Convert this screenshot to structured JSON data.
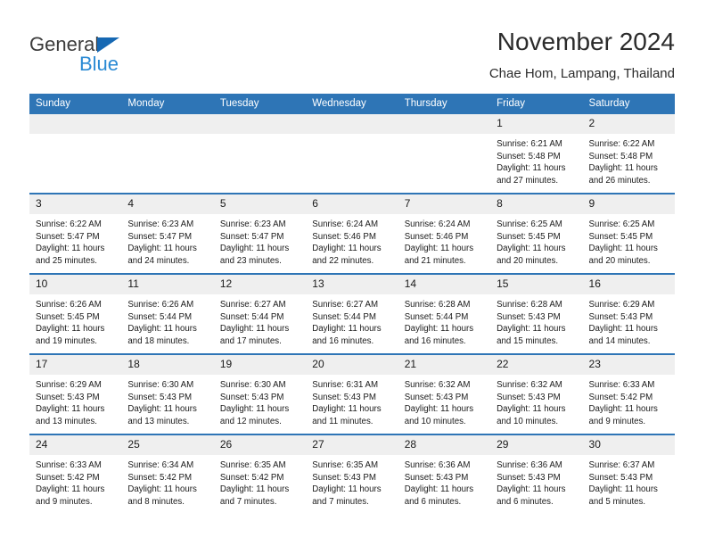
{
  "brand": {
    "name_dark": "General",
    "name_blue": "Blue",
    "triangle_color": "#1668b3",
    "blue_text_color": "#2a8ad4"
  },
  "header": {
    "title": "November 2024",
    "subtitle": "Chae Hom, Lampang, Thailand",
    "accent_color": "#2e75b6"
  },
  "weekdays": [
    "Sunday",
    "Monday",
    "Tuesday",
    "Wednesday",
    "Thursday",
    "Friday",
    "Saturday"
  ],
  "weeks": [
    [
      {
        "day": "",
        "sunrise": "",
        "sunset": "",
        "daylight1": "",
        "daylight2": ""
      },
      {
        "day": "",
        "sunrise": "",
        "sunset": "",
        "daylight1": "",
        "daylight2": ""
      },
      {
        "day": "",
        "sunrise": "",
        "sunset": "",
        "daylight1": "",
        "daylight2": ""
      },
      {
        "day": "",
        "sunrise": "",
        "sunset": "",
        "daylight1": "",
        "daylight2": ""
      },
      {
        "day": "",
        "sunrise": "",
        "sunset": "",
        "daylight1": "",
        "daylight2": ""
      },
      {
        "day": "1",
        "sunrise": "Sunrise: 6:21 AM",
        "sunset": "Sunset: 5:48 PM",
        "daylight1": "Daylight: 11 hours",
        "daylight2": "and 27 minutes."
      },
      {
        "day": "2",
        "sunrise": "Sunrise: 6:22 AM",
        "sunset": "Sunset: 5:48 PM",
        "daylight1": "Daylight: 11 hours",
        "daylight2": "and 26 minutes."
      }
    ],
    [
      {
        "day": "3",
        "sunrise": "Sunrise: 6:22 AM",
        "sunset": "Sunset: 5:47 PM",
        "daylight1": "Daylight: 11 hours",
        "daylight2": "and 25 minutes."
      },
      {
        "day": "4",
        "sunrise": "Sunrise: 6:23 AM",
        "sunset": "Sunset: 5:47 PM",
        "daylight1": "Daylight: 11 hours",
        "daylight2": "and 24 minutes."
      },
      {
        "day": "5",
        "sunrise": "Sunrise: 6:23 AM",
        "sunset": "Sunset: 5:47 PM",
        "daylight1": "Daylight: 11 hours",
        "daylight2": "and 23 minutes."
      },
      {
        "day": "6",
        "sunrise": "Sunrise: 6:24 AM",
        "sunset": "Sunset: 5:46 PM",
        "daylight1": "Daylight: 11 hours",
        "daylight2": "and 22 minutes."
      },
      {
        "day": "7",
        "sunrise": "Sunrise: 6:24 AM",
        "sunset": "Sunset: 5:46 PM",
        "daylight1": "Daylight: 11 hours",
        "daylight2": "and 21 minutes."
      },
      {
        "day": "8",
        "sunrise": "Sunrise: 6:25 AM",
        "sunset": "Sunset: 5:45 PM",
        "daylight1": "Daylight: 11 hours",
        "daylight2": "and 20 minutes."
      },
      {
        "day": "9",
        "sunrise": "Sunrise: 6:25 AM",
        "sunset": "Sunset: 5:45 PM",
        "daylight1": "Daylight: 11 hours",
        "daylight2": "and 20 minutes."
      }
    ],
    [
      {
        "day": "10",
        "sunrise": "Sunrise: 6:26 AM",
        "sunset": "Sunset: 5:45 PM",
        "daylight1": "Daylight: 11 hours",
        "daylight2": "and 19 minutes."
      },
      {
        "day": "11",
        "sunrise": "Sunrise: 6:26 AM",
        "sunset": "Sunset: 5:44 PM",
        "daylight1": "Daylight: 11 hours",
        "daylight2": "and 18 minutes."
      },
      {
        "day": "12",
        "sunrise": "Sunrise: 6:27 AM",
        "sunset": "Sunset: 5:44 PM",
        "daylight1": "Daylight: 11 hours",
        "daylight2": "and 17 minutes."
      },
      {
        "day": "13",
        "sunrise": "Sunrise: 6:27 AM",
        "sunset": "Sunset: 5:44 PM",
        "daylight1": "Daylight: 11 hours",
        "daylight2": "and 16 minutes."
      },
      {
        "day": "14",
        "sunrise": "Sunrise: 6:28 AM",
        "sunset": "Sunset: 5:44 PM",
        "daylight1": "Daylight: 11 hours",
        "daylight2": "and 16 minutes."
      },
      {
        "day": "15",
        "sunrise": "Sunrise: 6:28 AM",
        "sunset": "Sunset: 5:43 PM",
        "daylight1": "Daylight: 11 hours",
        "daylight2": "and 15 minutes."
      },
      {
        "day": "16",
        "sunrise": "Sunrise: 6:29 AM",
        "sunset": "Sunset: 5:43 PM",
        "daylight1": "Daylight: 11 hours",
        "daylight2": "and 14 minutes."
      }
    ],
    [
      {
        "day": "17",
        "sunrise": "Sunrise: 6:29 AM",
        "sunset": "Sunset: 5:43 PM",
        "daylight1": "Daylight: 11 hours",
        "daylight2": "and 13 minutes."
      },
      {
        "day": "18",
        "sunrise": "Sunrise: 6:30 AM",
        "sunset": "Sunset: 5:43 PM",
        "daylight1": "Daylight: 11 hours",
        "daylight2": "and 13 minutes."
      },
      {
        "day": "19",
        "sunrise": "Sunrise: 6:30 AM",
        "sunset": "Sunset: 5:43 PM",
        "daylight1": "Daylight: 11 hours",
        "daylight2": "and 12 minutes."
      },
      {
        "day": "20",
        "sunrise": "Sunrise: 6:31 AM",
        "sunset": "Sunset: 5:43 PM",
        "daylight1": "Daylight: 11 hours",
        "daylight2": "and 11 minutes."
      },
      {
        "day": "21",
        "sunrise": "Sunrise: 6:32 AM",
        "sunset": "Sunset: 5:43 PM",
        "daylight1": "Daylight: 11 hours",
        "daylight2": "and 10 minutes."
      },
      {
        "day": "22",
        "sunrise": "Sunrise: 6:32 AM",
        "sunset": "Sunset: 5:43 PM",
        "daylight1": "Daylight: 11 hours",
        "daylight2": "and 10 minutes."
      },
      {
        "day": "23",
        "sunrise": "Sunrise: 6:33 AM",
        "sunset": "Sunset: 5:42 PM",
        "daylight1": "Daylight: 11 hours",
        "daylight2": "and 9 minutes."
      }
    ],
    [
      {
        "day": "24",
        "sunrise": "Sunrise: 6:33 AM",
        "sunset": "Sunset: 5:42 PM",
        "daylight1": "Daylight: 11 hours",
        "daylight2": "and 9 minutes."
      },
      {
        "day": "25",
        "sunrise": "Sunrise: 6:34 AM",
        "sunset": "Sunset: 5:42 PM",
        "daylight1": "Daylight: 11 hours",
        "daylight2": "and 8 minutes."
      },
      {
        "day": "26",
        "sunrise": "Sunrise: 6:35 AM",
        "sunset": "Sunset: 5:42 PM",
        "daylight1": "Daylight: 11 hours",
        "daylight2": "and 7 minutes."
      },
      {
        "day": "27",
        "sunrise": "Sunrise: 6:35 AM",
        "sunset": "Sunset: 5:43 PM",
        "daylight1": "Daylight: 11 hours",
        "daylight2": "and 7 minutes."
      },
      {
        "day": "28",
        "sunrise": "Sunrise: 6:36 AM",
        "sunset": "Sunset: 5:43 PM",
        "daylight1": "Daylight: 11 hours",
        "daylight2": "and 6 minutes."
      },
      {
        "day": "29",
        "sunrise": "Sunrise: 6:36 AM",
        "sunset": "Sunset: 5:43 PM",
        "daylight1": "Daylight: 11 hours",
        "daylight2": "and 6 minutes."
      },
      {
        "day": "30",
        "sunrise": "Sunrise: 6:37 AM",
        "sunset": "Sunset: 5:43 PM",
        "daylight1": "Daylight: 11 hours",
        "daylight2": "and 5 minutes."
      }
    ]
  ]
}
